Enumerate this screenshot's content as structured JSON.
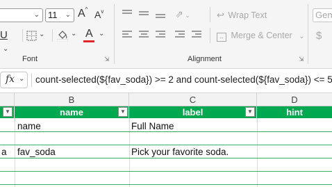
{
  "ribbon": {
    "font": {
      "font_size": "11",
      "grow_font": "A",
      "shrink_font": "A",
      "underline": "U",
      "font_color_letter": "A",
      "font_color": "#e0262b",
      "group_label": "Font"
    },
    "alignment": {
      "wrap_text": "Wrap Text",
      "merge_center": "Merge & Center",
      "group_label": "Alignment"
    },
    "number": {
      "format_value": "Gene",
      "currency_symbol": "$"
    }
  },
  "formula_bar": {
    "fx_label": "fx",
    "formula": "count-selected(${fav_soda}) >= 2 and count-selected(${fav_soda}) <= 5"
  },
  "sheet": {
    "header_color": "#00a84f",
    "columns": [
      "B",
      "C",
      "D"
    ],
    "headers": [
      "name",
      "label",
      "hint"
    ],
    "rows": [
      {
        "a": "",
        "b": "name",
        "c": "Full Name",
        "d": ""
      },
      {
        "a": "",
        "b": "",
        "c": "",
        "d": ""
      },
      {
        "a": "a",
        "b": "fav_soda",
        "c": "Pick your favorite soda.",
        "d": ""
      },
      {
        "a": "",
        "b": "",
        "c": "",
        "d": ""
      },
      {
        "a": "",
        "b": "",
        "c": "",
        "d": ""
      }
    ]
  }
}
